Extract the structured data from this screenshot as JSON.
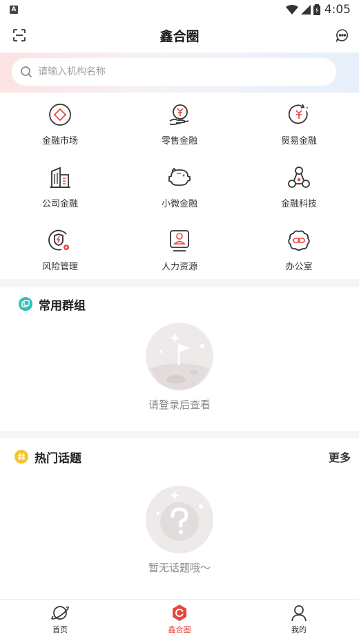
{
  "status_bar": {
    "time": "4:05",
    "app_indicator": "A"
  },
  "nav": {
    "title": "鑫合圈"
  },
  "search": {
    "placeholder": "请输入机构名称"
  },
  "grid": [
    {
      "label": "金融市场",
      "icon": "diamond-icon"
    },
    {
      "label": "零售金融",
      "icon": "yuan-hand-icon"
    },
    {
      "label": "贸易金融",
      "icon": "yuan-refresh-icon"
    },
    {
      "label": "公司金融",
      "icon": "building-icon"
    },
    {
      "label": "小微金融",
      "icon": "piggy-bank-icon"
    },
    {
      "label": "金融科技",
      "icon": "network-icon"
    },
    {
      "label": "风险管理",
      "icon": "shield-gear-icon"
    },
    {
      "label": "人力资源",
      "icon": "person-card-icon"
    },
    {
      "label": "办公室",
      "icon": "link-flower-icon"
    }
  ],
  "groups": {
    "title": "常用群组",
    "empty_text": "请登录后查看"
  },
  "topics": {
    "title": "热门话题",
    "more": "更多",
    "empty_text": "暂无话题哦～"
  },
  "tabbar": [
    {
      "label": "首页",
      "icon": "planet-icon",
      "active": false
    },
    {
      "label": "鑫合圈",
      "icon": "circle-logo-icon",
      "active": true
    },
    {
      "label": "我的",
      "icon": "user-icon",
      "active": false
    }
  ],
  "colors": {
    "accent": "#e8453c",
    "teal": "#2fc1b5",
    "yellow": "#f7c437"
  }
}
